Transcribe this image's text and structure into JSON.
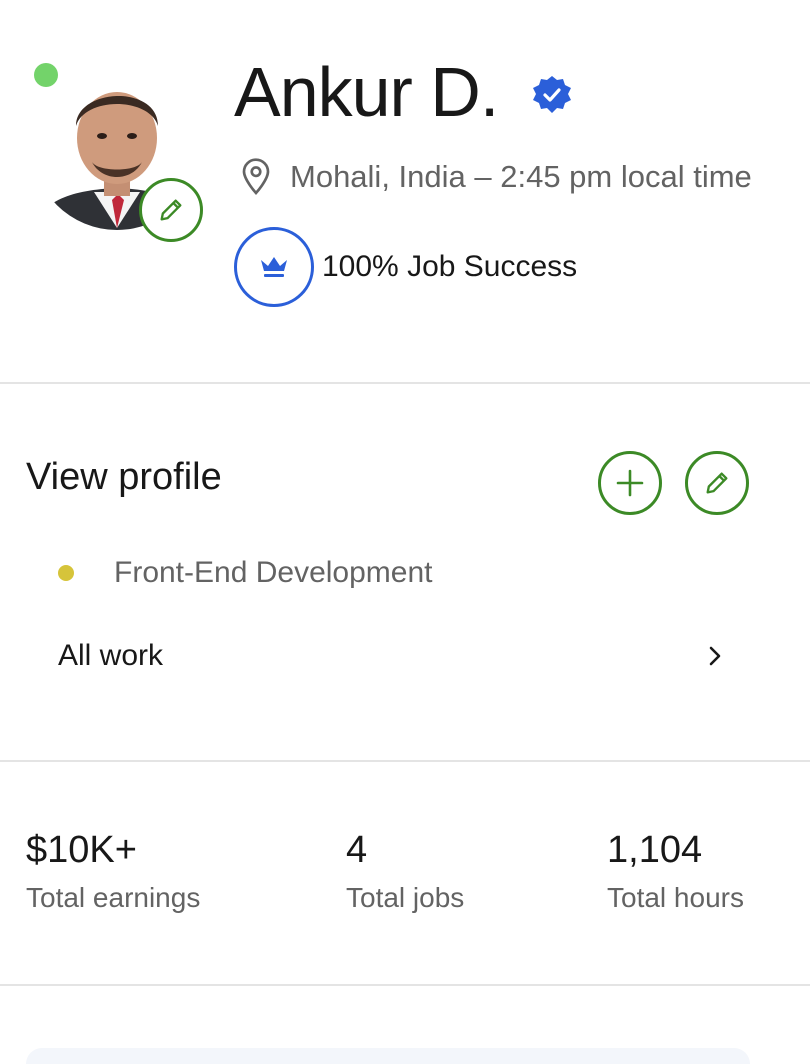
{
  "profile": {
    "name": "Ankur D.",
    "location": "Mohali, India – 2:45 pm local time",
    "job_success": "100% Job Success",
    "status_color": "#73d36a",
    "verified_color": "#2b5fd9"
  },
  "profile_section": {
    "title": "View profile",
    "add_icon": "plus-icon",
    "edit_icon": "pencil-icon",
    "skills": [
      {
        "label": "Front-End Development",
        "dot_color": "#d6c43a"
      }
    ],
    "all_work_label": "All work"
  },
  "stats": [
    {
      "value": "$10K+",
      "label": "Total earnings"
    },
    {
      "value": "4",
      "label": "Total jobs"
    },
    {
      "value": "1,104",
      "label": "Total hours"
    }
  ],
  "colors": {
    "accent_green": "#3c8a26",
    "text_primary": "#181818",
    "text_secondary": "#636363",
    "divider": "#e4e4e4"
  }
}
